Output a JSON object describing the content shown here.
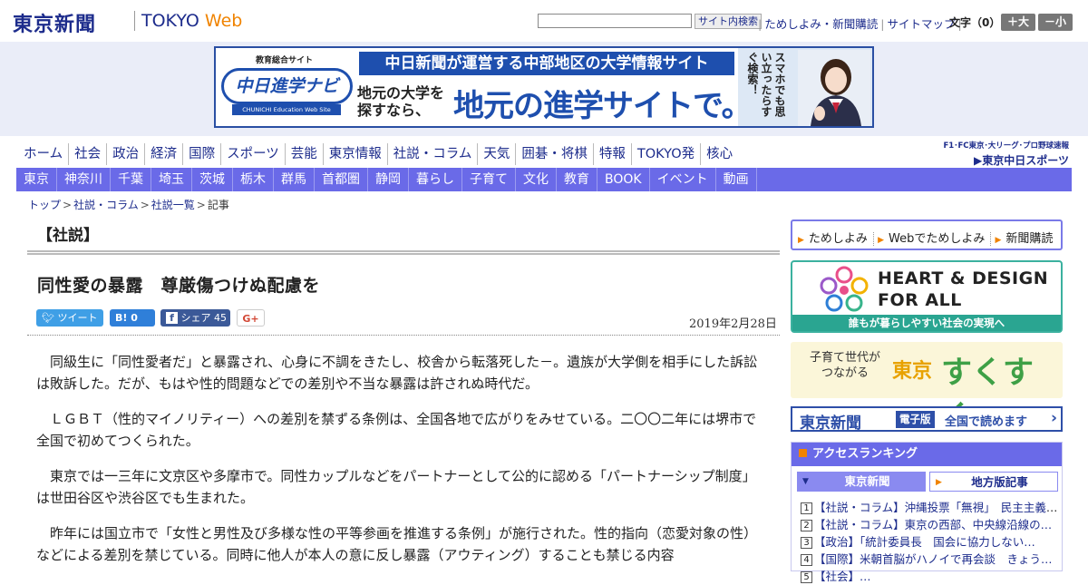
{
  "header": {
    "logo": "東京新聞",
    "site_name_a": "TOKYO",
    "site_name_b": "Web",
    "search_button": "サイト内検索",
    "links": [
      "ためしよみ・新聞購読",
      "サイトマップ"
    ],
    "font_size_label": "文字（0）",
    "font_plus": "＋大",
    "font_minus": "－小"
  },
  "ad": {
    "logo_small": "教育総合サイト",
    "logo_main": "中日進学ナビ",
    "logo_bar": "CHUNICHI Education Web Site",
    "top_text": "中日新聞が運営する中部地区の大学情報サイト",
    "mid_text": "地元の大学を探すなら、",
    "big_text": "地元の進学サイトで。",
    "vertical_text": "スマホでも思い立ったらすぐ検索！"
  },
  "nav_primary": [
    "ホーム",
    "社会",
    "政治",
    "経済",
    "国際",
    "スポーツ",
    "芸能",
    "東京情報",
    "社説・コラム",
    "天気",
    "囲碁・将棋",
    "特報",
    "TOKYO発",
    "核心"
  ],
  "chunichi_sports": {
    "small": "F1･FC東京･大リーグ･プロ野球速報",
    "big": "▶東京中日スポーツ"
  },
  "nav_secondary": [
    "東京",
    "神奈川",
    "千葉",
    "埼玉",
    "茨城",
    "栃木",
    "群馬",
    "首都圏",
    "静岡",
    "暮らし",
    "子育て",
    "文化",
    "教育",
    "BOOK",
    "イベント",
    "動画"
  ],
  "breadcrumb": [
    "トップ",
    "社説・コラム",
    "社説一覧",
    "記事"
  ],
  "article": {
    "section": "【社説】",
    "title": "同性愛の暴露　尊厳傷つけぬ配慮を",
    "date": "2019年2月28日",
    "share": {
      "tweet": "ツイート",
      "hatena": "0",
      "facebook": "シェア 45",
      "gplus": "G+"
    },
    "paragraphs": [
      "同級生に「同性愛者だ」と暴露され、心身に不調をきたし、校舎から転落死した－。遺族が大学側を相手にした訴訟は敗訴した。だが、もはや性的問題などでの差別や不当な暴露は許されぬ時代だ。",
      "ＬＧＢＴ（性的マイノリティー）への差別を禁ずる条例は、全国各地で広がりをみせている。二〇〇二年には堺市で全国で初めてつくられた。",
      "東京では一三年に文京区や多摩市で。同性カップルなどをパートナーとして公的に認める「パートナーシップ制度」は世田谷区や渋谷区でも生まれた。",
      "昨年には国立市で「女性と男性及び多様な性の平等参画を推進する条例」が施行された。性的指向（恋愛対象の性）などによる差別を禁じている。同時に他人が本人の意に反し暴露（アウティング）することも禁じる内容"
    ]
  },
  "sidebar": {
    "links": [
      "ためしよみ",
      "Webでためしよみ",
      "新聞購読"
    ],
    "heart_design": {
      "line1": "HEART & DESIGN",
      "line2": "FOR ALL",
      "bar": "誰もが暮らしやすい社会の実現へ"
    },
    "sukusuku": {
      "small": "子育て世代が つながる",
      "tokyo": "東京",
      "main": "すくすく"
    },
    "epaper": {
      "logo": "東京新聞",
      "badge": "電子版",
      "text": "全国で読めます"
    },
    "ranking": {
      "title": "アクセスランキング",
      "tabs": [
        "東京新聞",
        "地方版記事"
      ],
      "items": [
        "【社説・コラム】沖縄投票「無視」　民主主義を…",
        "【社説・コラム】東京の西部、中央線沿線の…",
        "【政治】「統計委員長　国会に協力しない…",
        "【国際】米朝首脳がハノイで再会談　きょう…",
        "【社会】…"
      ]
    }
  },
  "colors": {
    "brand_navy": "#1d2c8c",
    "nav_blue": "#6a6ae8",
    "accent_orange": "#f08300",
    "teal": "#2aa591"
  }
}
